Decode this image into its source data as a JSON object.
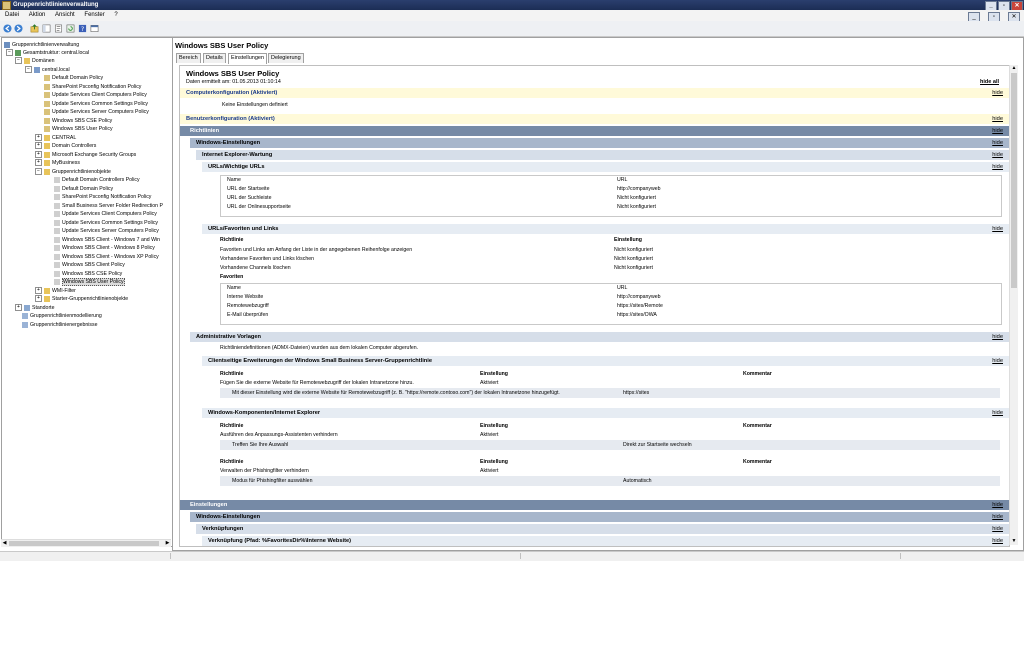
{
  "window": {
    "title": "Gruppenrichtlinienverwaltung",
    "buttons": [
      "_",
      "▫",
      "✕"
    ]
  },
  "menu": {
    "items": [
      "Datei",
      "Aktion",
      "Ansicht",
      "Fenster",
      "?"
    ]
  },
  "toolbar": {
    "icons": [
      "back-arrow-icon",
      "forward-arrow-icon",
      "up-folder-icon",
      "tree-view-icon",
      "properties-icon",
      "refresh-icon",
      "help-icon",
      "console-icon"
    ]
  },
  "tree": {
    "items": [
      {
        "label": "Gruppenrichtlinienverwaltung",
        "icon": "gpm-icon"
      },
      {
        "label": "Gesamtstruktur: central.local",
        "icon": "forest-icon"
      },
      {
        "label": "Domänen",
        "icon": "folder-icon"
      },
      {
        "label": "central.local",
        "icon": "domain-icon"
      },
      {
        "label": "Default Domain Policy",
        "icon": "gpo-link-icon"
      },
      {
        "label": "SharePoint Psconfig Notification Policy",
        "icon": "gpo-link-icon"
      },
      {
        "label": "Update Services Client Computers Policy",
        "icon": "gpo-link-icon"
      },
      {
        "label": "Update Services Common Settings Policy",
        "icon": "gpo-link-icon"
      },
      {
        "label": "Update Services Server Computers Policy",
        "icon": "gpo-link-icon"
      },
      {
        "label": "Windows SBS CSE Policy",
        "icon": "gpo-link-icon"
      },
      {
        "label": "Windows SBS User Policy",
        "icon": "gpo-link-icon"
      },
      {
        "label": "CENTRAL",
        "icon": "ou-icon"
      },
      {
        "label": "Domain Controllers",
        "icon": "ou-icon"
      },
      {
        "label": "Microsoft Exchange Security Groups",
        "icon": "ou-icon"
      },
      {
        "label": "MyBusiness",
        "icon": "ou-icon"
      },
      {
        "label": "Gruppenrichtlinienobjekte",
        "icon": "folder-icon"
      },
      {
        "label": "Default Domain Controllers Policy",
        "icon": "gpo-icon"
      },
      {
        "label": "Default Domain Policy",
        "icon": "gpo-icon"
      },
      {
        "label": "SharePoint Psconfig Notification Policy",
        "icon": "gpo-icon"
      },
      {
        "label": "Small Business Server Folder Redirection P",
        "icon": "gpo-icon"
      },
      {
        "label": "Update Services Client Computers Policy",
        "icon": "gpo-icon"
      },
      {
        "label": "Update Services Common Settings Policy",
        "icon": "gpo-icon"
      },
      {
        "label": "Update Services Server Computers Policy",
        "icon": "gpo-icon"
      },
      {
        "label": "Windows SBS Client - Windows 7 and Win",
        "icon": "gpo-icon"
      },
      {
        "label": "Windows SBS Client - Windows 8 Policy",
        "icon": "gpo-icon"
      },
      {
        "label": "Windows SBS Client - Windows XP Policy",
        "icon": "gpo-icon"
      },
      {
        "label": "Windows SBS Client Policy",
        "icon": "gpo-icon"
      },
      {
        "label": "Windows SBS CSE Policy",
        "icon": "gpo-icon"
      },
      {
        "label": "Windows SBS User Policy",
        "icon": "gpo-icon"
      },
      {
        "label": "WMI-Filter",
        "icon": "folder-icon"
      },
      {
        "label": "Starter-Gruppenrichtlinienobjekte",
        "icon": "folder-icon"
      },
      {
        "label": "Standorte",
        "icon": "sites-icon"
      },
      {
        "label": "Gruppenrichtlinienmodellierung",
        "icon": "modeling-icon"
      },
      {
        "label": "Gruppenrichtlinienergebnisse",
        "icon": "results-icon"
      }
    ]
  },
  "detail": {
    "title": "Windows SBS User Policy",
    "tabs": [
      "Bereich",
      "Details",
      "Einstellungen",
      "Delegierung"
    ],
    "active_tab": "Einstellungen"
  },
  "report": {
    "title": "Windows SBS User Policy",
    "date": "Daten ermittelt am: 01.05.2013 01:10:14",
    "hide_all": "hide all",
    "hide": "hide",
    "computer_config": "Computerkonfiguration (Aktiviert)",
    "computer_none": "Keine Einstellungen definiert",
    "user_config": "Benutzerkonfiguration (Aktiviert)",
    "richtlinien": "Richtlinien",
    "windows_einstellungen": "Windows-Einstellungen",
    "ie_wartung": "Internet Explorer-Wartung",
    "urls_wichtige": "URLs/Wichtige URLs",
    "url_table": {
      "header": [
        "Name",
        "URL"
      ],
      "rows": [
        [
          "URL der Startseite",
          "http://companyweb"
        ],
        [
          "URL der Suchleiste",
          "Nicht konfiguriert"
        ],
        [
          "URL der Onlinesupportseite",
          "Nicht konfiguriert"
        ]
      ]
    },
    "urls_favoriten": "URLs/Favoriten und Links",
    "fav_policy": {
      "header": [
        "Richtlinie",
        "Einstellung"
      ],
      "rows": [
        [
          "Favoriten und Links am Anfang der Liste in der angegebenen Reihenfolge anzeigen",
          "Nicht konfiguriert"
        ],
        [
          "Vorhandene Favoriten und Links löschen",
          "Nicht konfiguriert"
        ],
        [
          "Vorhandene Channels löschen",
          "Nicht konfiguriert"
        ]
      ]
    },
    "favoriten_label": "Favoriten",
    "fav_table": {
      "header": [
        "Name",
        "URL"
      ],
      "rows": [
        [
          "Interne Website",
          "http://companyweb"
        ],
        [
          "Remotewebzugriff",
          "https://sites/Remote"
        ],
        [
          "E-Mail überprüfen",
          "https://sites/OWA"
        ]
      ]
    },
    "admin_templates": "Administrative Vorlagen",
    "admx_note": "Richtliniendefinitionen (ADMX-Dateien) wurden aus dem lokalen Computer abgerufen.",
    "clientseitige": "Clientseitige Erweiterungen der Windows Small Business Server-Gruppenrichtlinie",
    "cse_table": {
      "header": [
        "Richtlinie",
        "Einstellung",
        "Kommentar"
      ],
      "row": [
        "Fügen Sie die externe Website für Remotewebzugriff der lokalen Intranetzone hinzu.",
        "Aktiviert"
      ],
      "sub": [
        "Mit dieser Einstellung wird die externe Website für Remotewebzugriff (z. B. \"https://remote.contoso.com\") der lokalen Intranetzone hinzugefügt.",
        "https://sites"
      ]
    },
    "win_komponenten": "Windows-Komponenten/Internet Explorer",
    "ie_table1": {
      "header": [
        "Richtlinie",
        "Einstellung",
        "Kommentar"
      ],
      "row": [
        "Ausführen des Anpassungs-Assistenten verhindern",
        "Aktiviert"
      ],
      "sub": [
        "Treffen Sie Ihre Auswahl",
        "Direkt zur Startseite wechseln"
      ]
    },
    "ie_table2": {
      "header": [
        "Richtlinie",
        "Einstellung",
        "Kommentar"
      ],
      "row": [
        "Verwalten der Phishingfilter verhindern",
        "Aktiviert"
      ],
      "sub": [
        "Modus für Phishingfilter auswählen",
        "Automatisch"
      ]
    },
    "einstellungen": "Einstellungen",
    "windows_einstellungen2": "Windows-Einstellungen",
    "verknuepfungen": "Verknüpfungen",
    "verknuepfung_item": "Verknüpfung (Pfad: %FavoritesDir%\\Interne Website)"
  }
}
